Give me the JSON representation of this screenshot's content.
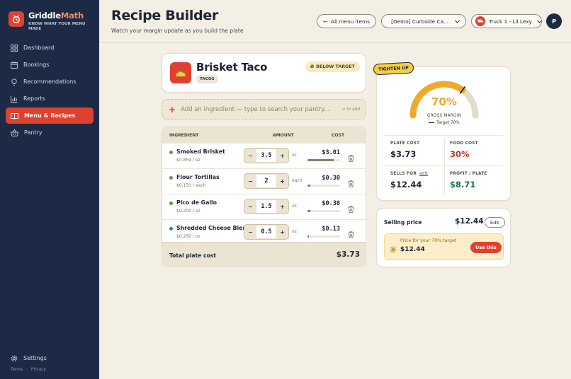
{
  "brand": {
    "name_main": "Griddle",
    "name_accent": "Math",
    "tagline": "KNOW WHAT YOUR MENU MADE"
  },
  "sidebar": {
    "items": [
      {
        "label": "Dashboard",
        "icon": "dashboard-grid-icon"
      },
      {
        "label": "Bookings",
        "icon": "calendar-icon"
      },
      {
        "label": "Recommendations",
        "icon": "lightbulb-icon"
      },
      {
        "label": "Reports",
        "icon": "bar-chart-icon"
      },
      {
        "label": "Menu & Recipes",
        "icon": "book-icon",
        "active": true
      },
      {
        "label": "Pantry",
        "icon": "basket-icon"
      }
    ],
    "settings_label": "Settings",
    "terms": "Terms",
    "privacy": "Privacy"
  },
  "header": {
    "title": "Recipe Builder",
    "subtitle": "Watch your margin update as you build the plate",
    "back_label": "All menu items",
    "location_label": "[Demo] Curbside Ca...",
    "truck_label": "Truck 1 - Lil Lexy",
    "avatar_initial": "P"
  },
  "recipe": {
    "name": "Brisket Taco",
    "category": "TACOS",
    "status_badge": "BELOW TARGET"
  },
  "add_ingredient": {
    "placeholder": "Add an ingredient — type to search your pantry...",
    "hint": "↵ to add"
  },
  "ingredients_table": {
    "headers": {
      "ingredient": "INGREDIENT",
      "amount": "AMOUNT",
      "cost": "COST"
    },
    "rows": [
      {
        "name": "Smoked Brisket",
        "unit_price": "$0.859 / oz",
        "amount": "3.5",
        "unit": "oz",
        "cost": "$3.01",
        "cost_share": 0.81,
        "dot_color": "#8a7f6e",
        "bar_color": "#8a7f6e"
      },
      {
        "name": "Flour Tortillas",
        "unit_price": "$0.150 / each",
        "amount": "2",
        "unit": "each",
        "cost": "$0.30",
        "cost_share": 0.08,
        "dot_color": "#8a7f6e",
        "bar_color": "#8a7f6e"
      },
      {
        "name": "Pico de Gallo",
        "unit_price": "$0.200 / oz",
        "amount": "1.5",
        "unit": "oz",
        "cost": "$0.30",
        "cost_share": 0.08,
        "dot_color": "#4a9a3a",
        "bar_color": "#4a9a3a"
      },
      {
        "name": "Shredded Cheese Blend",
        "unit_price": "$0.250 / oz",
        "amount": "0.5",
        "unit": "oz",
        "cost": "$0.13",
        "cost_share": 0.035,
        "dot_color": "#2e8a8a",
        "bar_color": "#2e8a8a"
      }
    ],
    "total_label": "Total plate cost",
    "total_value": "$3.73"
  },
  "margin": {
    "callout": "TIGHTEN UP",
    "value_text": "70%",
    "gauge_fraction": 0.7,
    "target_fraction": 0.7,
    "label": "GROSS MARGIN",
    "target_label": "Target 70%",
    "gauge_color": "#efa92b",
    "track_color": "#e2dccb",
    "plate_cost_label": "PLATE COST",
    "plate_cost": "$3.73",
    "food_cost_label": "FOOD COST",
    "food_cost": "30%",
    "sells_for_label": "SELLS FOR",
    "sells_for_edit": "edit",
    "sells_for": "$12.44",
    "profit_label": "PROFIT / PLATE",
    "profit": "$8.71"
  },
  "selling": {
    "label": "Selling price",
    "value": "$12.44",
    "edit_label": "Edit",
    "suggestion_label": "Price for your 70% target",
    "suggestion_value": "$12.44",
    "use_label": "Use this"
  },
  "colors": {
    "accent": "#e0412f",
    "sidebar_bg": "#1c2a45",
    "page_bg": "#f4efe4",
    "warning": "#c0392b",
    "profit": "#1f6b5c"
  }
}
